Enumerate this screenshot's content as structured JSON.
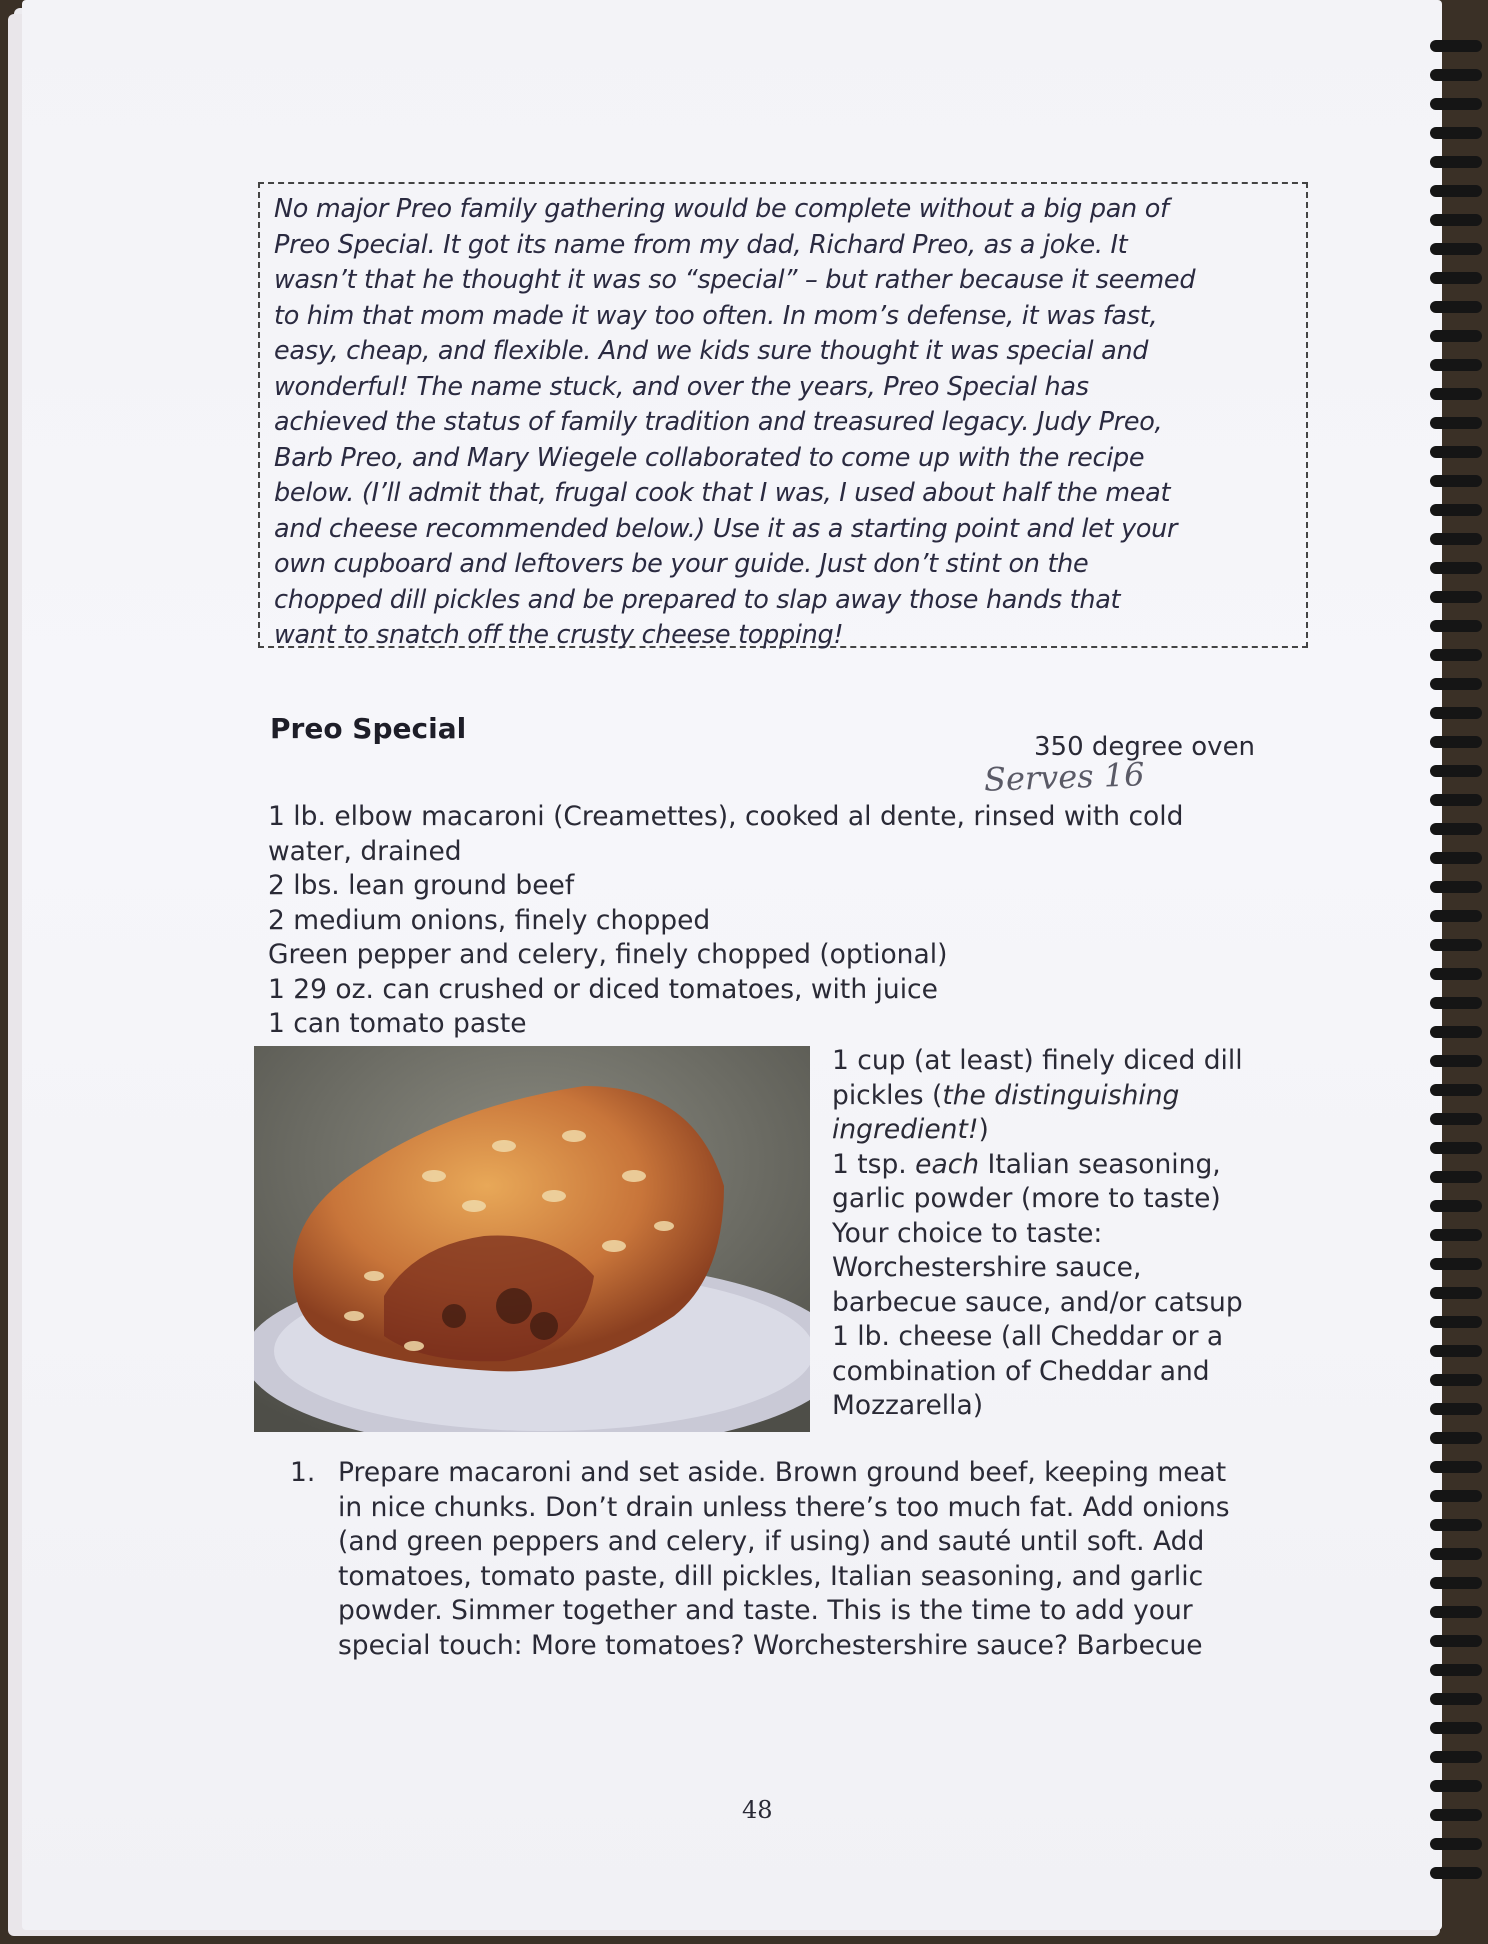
{
  "story": {
    "lines": [
      "No major Preo family gathering would be complete without a big pan of",
      "Preo Special. It got its name from my dad, Richard Preo, as a joke. It",
      "wasn’t that he thought it was so “special” – but rather because it seemed",
      "to him that mom made it way too often. In mom’s defense, it was fast,",
      "easy, cheap, and flexible. And we kids sure thought it was special and",
      "wonderful! The name stuck, and over the years, Preo Special has",
      "achieved the status of family tradition and treasured legacy. Judy Preo,",
      "Barb Preo, and Mary Wiegele collaborated to come up with the recipe",
      "below. (I’ll admit that, frugal cook that I was, I used about half the meat",
      "and cheese recommended below.) Use it as a starting point and let your",
      "own cupboard and leftovers be your guide. Just don’t stint on the",
      "chopped dill pickles and be prepared to slap away those hands that",
      "want to snatch off the crusty cheese topping!"
    ]
  },
  "recipe": {
    "title": "Preo Special",
    "oven": "350 degree oven",
    "serves_handwritten": "Serves 16",
    "ingredients_top": [
      "1 lb. elbow macaroni (Creamettes), cooked al dente, rinsed with cold",
      "water, drained",
      "2 lbs. lean ground beef",
      "2 medium onions, finely chopped",
      "Green pepper and celery, finely chopped (optional)",
      "1 29 oz. can crushed or diced tomatoes, with juice",
      "1 can tomato paste"
    ],
    "ingredients_side": {
      "pickles_line1": "1 cup (at least) finely diced dill",
      "pickles_line2_a": "pickles (",
      "pickles_line2_b": "the distinguishing",
      "pickles_line3_b": "ingredient!",
      "pickles_line3_c": ")",
      "seasoning_a": "1 tsp. ",
      "seasoning_b": "each",
      "seasoning_c": " Italian seasoning,",
      "rest": [
        "garlic powder (more to taste)",
        "Your choice to taste:",
        "Worchestershire sauce,",
        "barbecue sauce, and/or catsup",
        "1 lb. cheese (all Cheddar or a",
        "combination of Cheddar and",
        "Mozzarella)"
      ]
    },
    "step1": {
      "number": "1.",
      "lines": [
        "Prepare macaroni and set aside. Brown ground beef, keeping meat",
        "in nice chunks. Don’t drain unless there’s too much fat. Add onions",
        "(and green peppers and celery, if using) and sauté until soft. Add",
        "tomatoes, tomato paste, dill pickles, Italian seasoning, and garlic",
        "powder. Simmer together and taste. This is the time to add your",
        "special touch: More tomatoes? Worchestershire sauce? Barbecue"
      ]
    }
  },
  "page_number": "48",
  "photo_icon": "baked-macaroni-casserole-photo"
}
